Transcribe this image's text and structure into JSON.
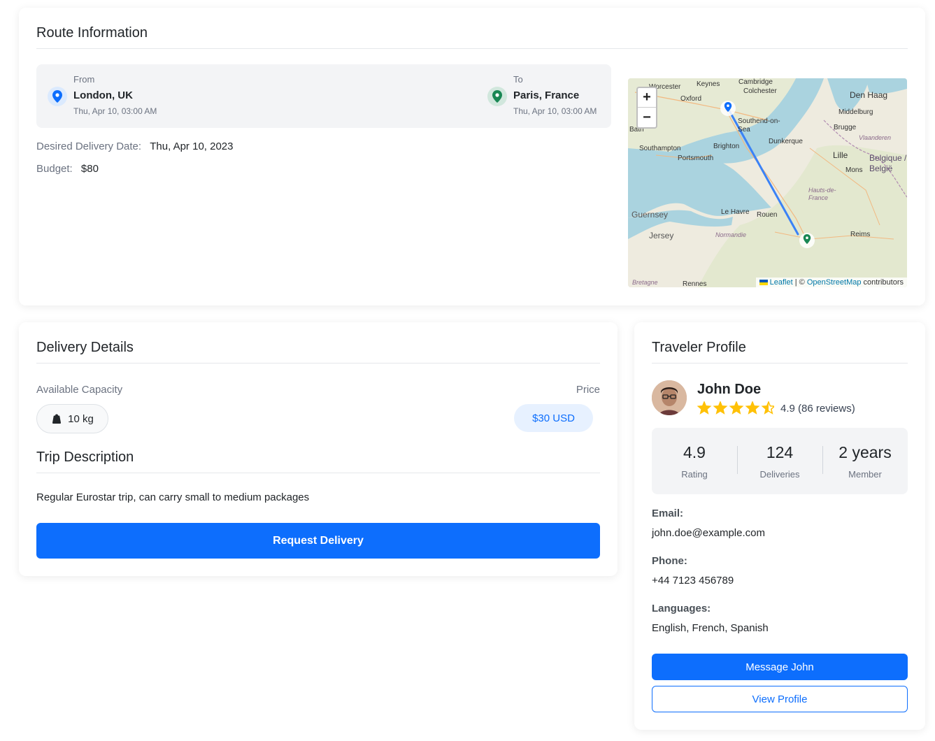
{
  "route": {
    "title": "Route Information",
    "from": {
      "label": "From",
      "place": "London, UK",
      "datetime": "Thu, Apr 10, 03:00 AM"
    },
    "to": {
      "label": "To",
      "place": "Paris, France",
      "datetime": "Thu, Apr 10, 03:00 AM"
    },
    "desired_label": "Desired Delivery Date:",
    "desired_value": "Thu, Apr 10, 2023",
    "budget_label": "Budget:",
    "budget_value": "$80",
    "map": {
      "zoom_in": "+",
      "zoom_out": "−",
      "attribution_leaflet": "Leaflet",
      "attribution_sep": " | © ",
      "attribution_osm": "OpenStreetMap",
      "attribution_suffix": " contributors",
      "labels": [
        "Cambridge",
        "Colchester",
        "Oxford",
        "Southend-on-Sea",
        "Den Haag",
        "Middelburg",
        "Brugge",
        "Dunkerque",
        "Lille",
        "Mons",
        "Belgique / België",
        "Brighton",
        "Southampton",
        "Portsmouth",
        "Bath",
        "Guernsey",
        "Jersey",
        "Le Havre",
        "Rouen",
        "Reims",
        "Hauts-de-France",
        "Normandie",
        "Bretagne",
        "Rennes",
        "Vlaanderen",
        "Keynes",
        "Worcester"
      ]
    }
  },
  "delivery": {
    "title": "Delivery Details",
    "capacity_label": "Available Capacity",
    "capacity_value": "10 kg",
    "price_label": "Price",
    "price_value": "$30 USD",
    "trip_title": "Trip Description",
    "trip_desc": "Regular Eurostar trip, can carry small to medium packages",
    "request_button": "Request Delivery"
  },
  "traveler": {
    "title": "Traveler Profile",
    "name": "John Doe",
    "rating_text": "4.9 (86 reviews)",
    "stars": 4.5,
    "stats": [
      {
        "value": "4.9",
        "label": "Rating"
      },
      {
        "value": "124",
        "label": "Deliveries"
      },
      {
        "value": "2 years",
        "label": "Member"
      }
    ],
    "email_label": "Email:",
    "email": "john.doe@example.com",
    "phone_label": "Phone:",
    "phone": "+44 7123 456789",
    "languages_label": "Languages:",
    "languages": "English, French, Spanish",
    "message_button": "Message John",
    "profile_button": "View Profile"
  },
  "colors": {
    "primary": "#0d6efd",
    "from_pin": "#0d6efd",
    "to_pin": "#198754",
    "star": "#ffc107",
    "route_line": "#3b82f6"
  }
}
